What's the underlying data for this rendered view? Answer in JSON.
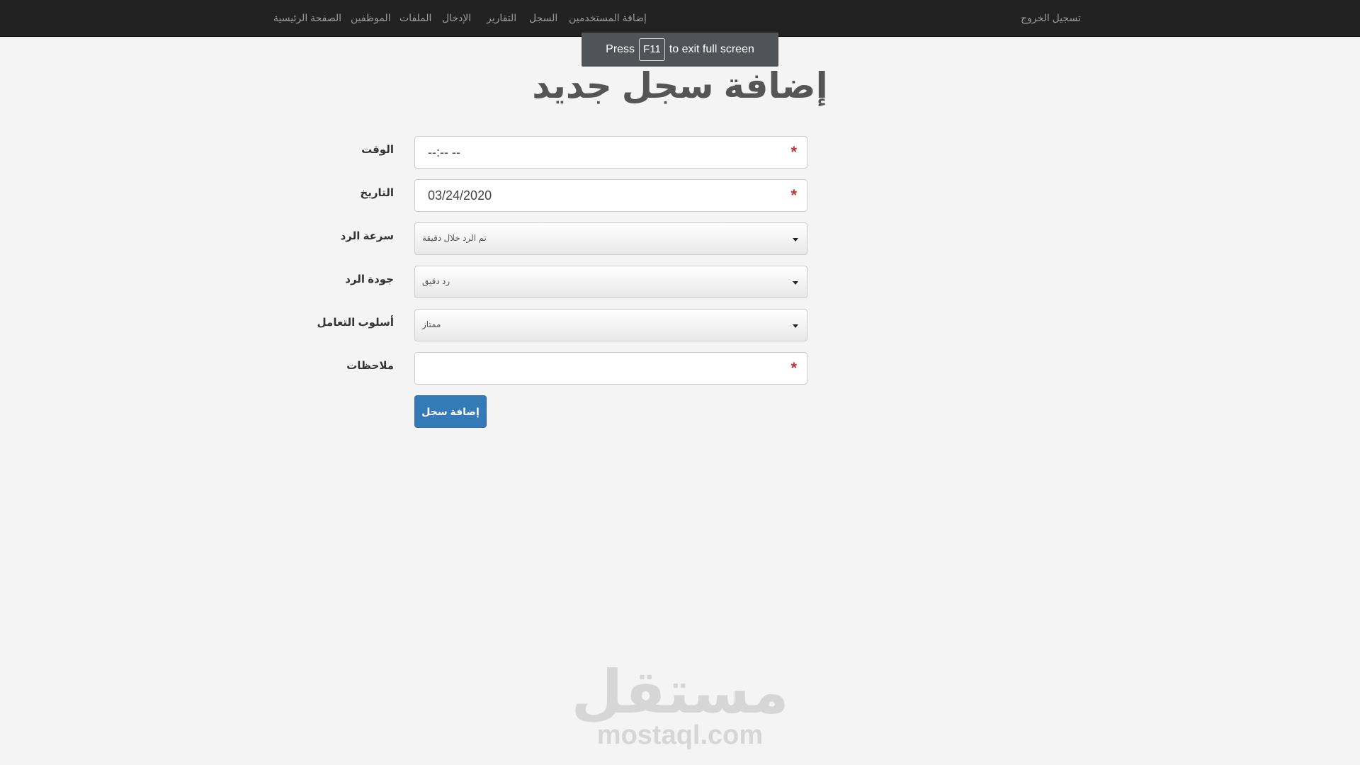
{
  "nav": {
    "logout": "تسجيل الخروج",
    "items": [
      "إضافة المستخدمين",
      "السجل",
      "التقارير",
      "الإدخال",
      "الملفات",
      "الموظفين",
      "الصفحة الرئيسية"
    ]
  },
  "fullscreen_notice": {
    "before": "Press",
    "key": "F11",
    "after": "to exit full screen"
  },
  "page": {
    "title": "إضافة سجل جديد"
  },
  "form": {
    "time": {
      "label": "الوقت",
      "value": "--:-- --",
      "required_mark": "*"
    },
    "date": {
      "label": "التاريخ",
      "value": "03/24/2020",
      "required_mark": "*"
    },
    "response_speed": {
      "label": "سرعة الرد",
      "selected": "تم الرد خلال دقيقة"
    },
    "response_quality": {
      "label": "جودة الرد",
      "selected": "رد دقيق"
    },
    "handling_style": {
      "label": "أسلوب التعامل",
      "selected": "ممتاز"
    },
    "notes": {
      "label": "ملاحظات",
      "value": "",
      "required_mark": "*"
    },
    "submit_label": "إضافة سجل"
  },
  "watermark": {
    "arabic": "مستقل",
    "latin": "mostaql.com"
  },
  "colors": {
    "navbar": "#222222",
    "primary_button": "#337ab7",
    "required": "#c9302c"
  }
}
